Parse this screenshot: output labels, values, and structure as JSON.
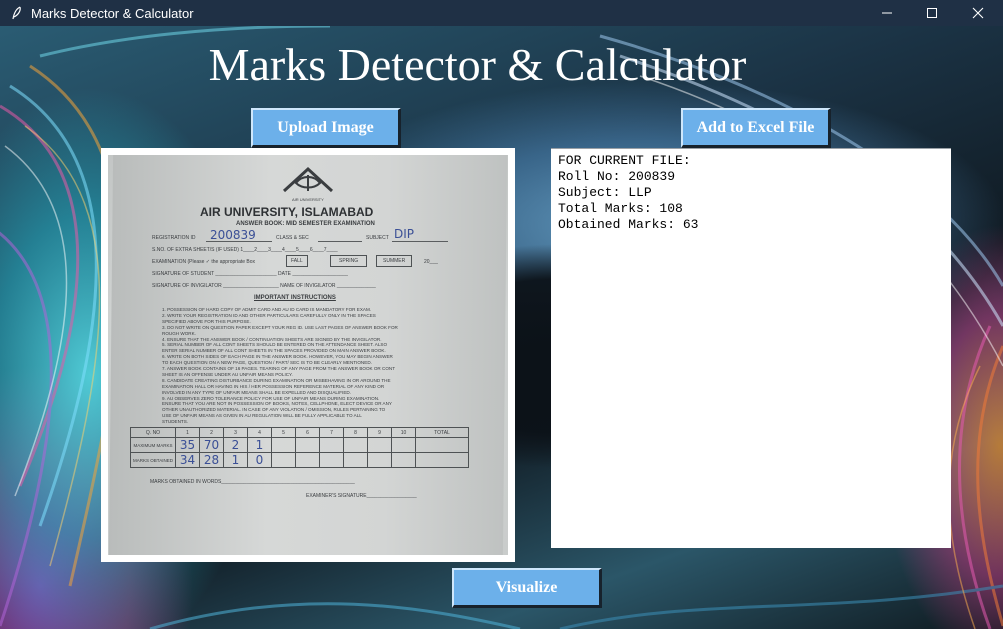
{
  "window": {
    "title": "Marks Detector & Calculator"
  },
  "header": {
    "title": "Marks Detector & Calculator"
  },
  "buttons": {
    "upload": "Upload Image",
    "excel": "Add to Excel File",
    "visualize": "Visualize"
  },
  "output": {
    "lines": [
      "FOR CURRENT FILE:",
      "Roll No: 200839",
      "Subject: LLP",
      "Total Marks: 108",
      "Obtained Marks: 63"
    ]
  },
  "answer_sheet": {
    "university": "AIR UNIVERSITY, ISLAMABAD",
    "subtitle": "ANSWER BOOK: MID SEMESTER EXAMINATION",
    "logo_text": "AIR UNIVERSITY",
    "reg_label": "REGISTRATION ID",
    "reg_value": "200839",
    "class_label": "CLASS & SEC",
    "subject_label": "SUBJECT",
    "subject_value": "DIP",
    "extra_sheets": "S.NO. OF EXTRA SHEET/S (IF USED) 1____2____3____4____5____6____7____",
    "exam_label": "EXAMINATION (Please ✓ the appropriate Box",
    "fall": "FALL",
    "spring": "SPRING",
    "summer": "SUMMER",
    "year": "20___",
    "sig_student": "SIGNATURE OF STUDENT ______________________ DATE ____________________",
    "sig_invig": "SIGNATURE OF INVIGILATOR ____________________ NAME OF INVIGILATOR ______________",
    "instructions_title": "IMPORTANT INSTRUCTIONS",
    "instructions": [
      "1.  POSSESSION OF HARD COPY OF ADMIT CARD AND AU ID CARD IS MANDATORY FOR EXAM.",
      "2.  WRITE YOUR REGISTRATION ID AND OTHER PARTICULARS CAREFULLY ONLY IN THE SPACES",
      "     SPECIFIED ABOVE FOR THIS PURPOSE.",
      "3.  DO NOT WRITE ON QUESTION PAPER EXCEPT YOUR REG ID. USE LAST PAGES OF ANSWER BOOK FOR",
      "     ROUGH WORK.",
      "4.  ENSURE THAT THE ANSWER BOOK / CONTINUATION SHEETS ARE SIGNED BY THE INVIGILATOR.",
      "5.  SERIAL NUMBER OF ALL CONT SHEETS SHOULD BE ENTERED ON THE ATTENDANCE SHEET. ALSO",
      "     ENTER SERIAL NUMBER OF ALL CONT SHEETS IN THE SPACES PROVIDED ON MAIN ANSWER BOOK.",
      "6.  WRITE ON BOTH SIDES OF EACH PAGE IN THE ANSWER BOOK. HOWEVER, YOU MAY BEGIN ANSWER",
      "     TO EACH QUESTION ON A NEW PAGE, QUESTION / PART/ SEC IS TO BE CLEARLY MENTIONED.",
      "7.  ANSWER BOOK CONTAINS OF 16 PAGES. TEARING OF ANY PAGE FROM THE ANSWER BOOK OR CONT",
      "     SHEET IS AN OFFENSE UNDER AU UNFAIR MEANS POLICY.",
      "8.  CANDIDATE CREATING DISTURBANCE DURING EXAMINATION OR MISBEHAVING IN OR AROUND THE",
      "     EXAMINATION HALL OR HAVING IN HIS / HER POSSESSION REFERENCE MATERIAL OF ANY KIND OR",
      "     INVOLVED IN ANY TYPE OF UNFAIR MEANS SHALL BE EXPELLED AND DISQUALIFIED.",
      "9.  AU OBSERVES ZERO TOLERANCE POLICY FOR USE OF UNFAIR MEANS DURING EXAMINATION.",
      "     ENSURE THAT YOU ARE NOT IN POSSESSION OF BOOKS, NOTES, CELLPHONE, ELECT DEVICE OR ANY",
      "     OTHER UNAUTHORIZED MATERIAL. IN CASE OF ANY VIOLATION / OMISSION, RULES PERTAINING TO",
      "     USE OF UNFAIR MEANS AS GIVEN IN AU REGULATION WILL BE FULLY APPLICABLE TO ALL",
      "     STUDENTS."
    ],
    "table_header": [
      "Q. NO",
      "1",
      "2",
      "3",
      "4",
      "5",
      "6",
      "7",
      "8",
      "9",
      "10",
      "TOTAL"
    ],
    "row_max_label": "MAXIMUM MARKS",
    "row_obt_label": "MARKS OBTAINED",
    "max_marks": [
      "35",
      "70",
      "2",
      "1"
    ],
    "obt_marks": [
      "34",
      "28",
      "1",
      "0"
    ],
    "words_label": "MARKS OBTAINED IN WORDS________________________________________________",
    "examiner_label": "EXAMINER'S SIGNATURE__________________"
  }
}
